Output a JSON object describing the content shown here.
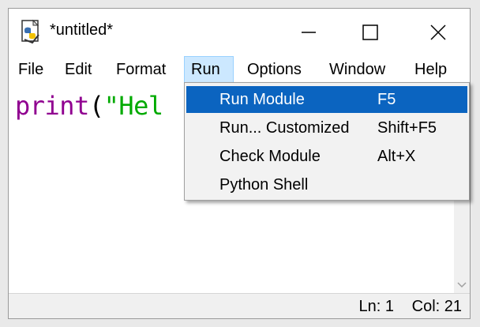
{
  "window": {
    "title": "*untitled*",
    "icon": "python-idle-icon"
  },
  "controls": {
    "minimize": "minimize-icon",
    "maximize": "maximize-icon",
    "close": "close-icon"
  },
  "menubar": {
    "items": [
      "File",
      "Edit",
      "Format",
      "Run",
      "Options",
      "Window",
      "Help"
    ],
    "active": "Run"
  },
  "editor": {
    "code_keyword": "print",
    "code_paren": "(",
    "code_string": "\"Hel"
  },
  "run_menu": {
    "items": [
      {
        "label": "Run Module",
        "shortcut": "F5"
      },
      {
        "label": "Run... Customized",
        "shortcut": "Shift+F5"
      },
      {
        "label": "Check Module",
        "shortcut": "Alt+X"
      },
      {
        "label": "Python Shell",
        "shortcut": ""
      }
    ],
    "highlighted_index": 0
  },
  "statusbar": {
    "line": "Ln: 1",
    "column": "Col: 21"
  },
  "colors": {
    "highlight": "#0b64c0",
    "menu_active_bg": "#cce8ff",
    "keyword": "#900090",
    "string": "#00aa00"
  }
}
